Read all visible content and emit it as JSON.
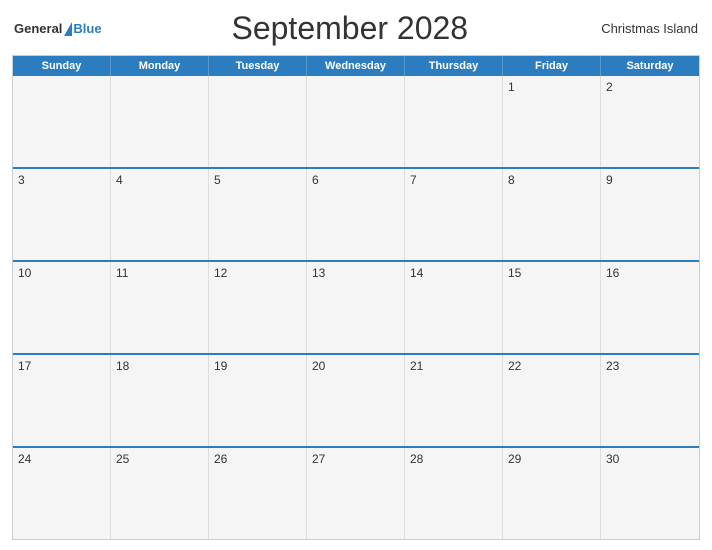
{
  "header": {
    "logo_general": "General",
    "logo_blue": "Blue",
    "title": "September 2028",
    "region": "Christmas Island"
  },
  "calendar": {
    "days_of_week": [
      "Sunday",
      "Monday",
      "Tuesday",
      "Wednesday",
      "Thursday",
      "Friday",
      "Saturday"
    ],
    "weeks": [
      [
        {
          "day": "",
          "empty": true
        },
        {
          "day": "",
          "empty": true
        },
        {
          "day": "",
          "empty": true
        },
        {
          "day": "",
          "empty": true
        },
        {
          "day": "",
          "empty": true
        },
        {
          "day": "1",
          "empty": false
        },
        {
          "day": "2",
          "empty": false
        }
      ],
      [
        {
          "day": "3",
          "empty": false
        },
        {
          "day": "4",
          "empty": false
        },
        {
          "day": "5",
          "empty": false
        },
        {
          "day": "6",
          "empty": false
        },
        {
          "day": "7",
          "empty": false
        },
        {
          "day": "8",
          "empty": false
        },
        {
          "day": "9",
          "empty": false
        }
      ],
      [
        {
          "day": "10",
          "empty": false
        },
        {
          "day": "11",
          "empty": false
        },
        {
          "day": "12",
          "empty": false
        },
        {
          "day": "13",
          "empty": false
        },
        {
          "day": "14",
          "empty": false
        },
        {
          "day": "15",
          "empty": false
        },
        {
          "day": "16",
          "empty": false
        }
      ],
      [
        {
          "day": "17",
          "empty": false
        },
        {
          "day": "18",
          "empty": false
        },
        {
          "day": "19",
          "empty": false
        },
        {
          "day": "20",
          "empty": false
        },
        {
          "day": "21",
          "empty": false
        },
        {
          "day": "22",
          "empty": false
        },
        {
          "day": "23",
          "empty": false
        }
      ],
      [
        {
          "day": "24",
          "empty": false
        },
        {
          "day": "25",
          "empty": false
        },
        {
          "day": "26",
          "empty": false
        },
        {
          "day": "27",
          "empty": false
        },
        {
          "day": "28",
          "empty": false
        },
        {
          "day": "29",
          "empty": false
        },
        {
          "day": "30",
          "empty": false
        }
      ]
    ]
  }
}
